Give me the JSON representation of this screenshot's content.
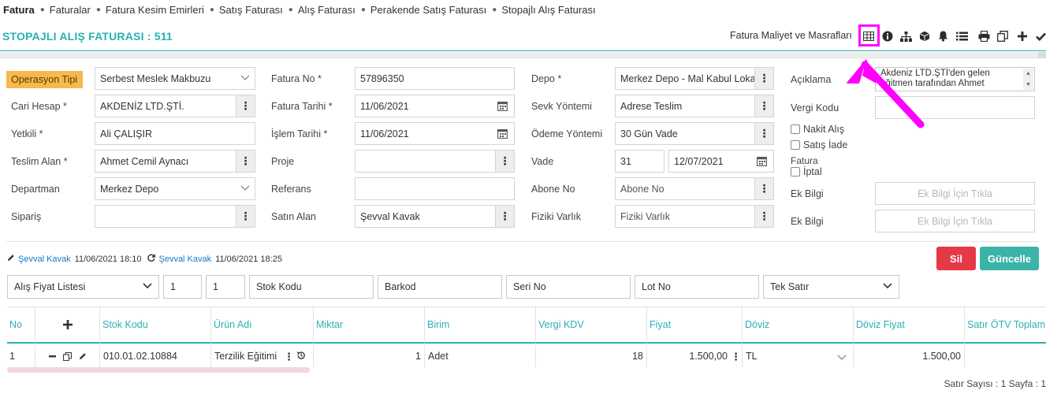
{
  "breadcrumb": [
    "Fatura",
    "Faturalar",
    "Fatura Kesim Emirleri",
    "Satış Faturası",
    "Alış Faturası",
    "Perakende Satış Faturası",
    "Stopajlı Alış Faturası"
  ],
  "header": {
    "title": "STOPAJLI ALIŞ FATURASI : 511",
    "cost_link": "Fatura Maliyet ve Masrafları",
    "toolbar_icons": [
      "table-icon",
      "info-icon",
      "sitemap-icon",
      "cube-icon",
      "bell-icon",
      "list-icon",
      "print-icon",
      "copy-icon",
      "plus-icon",
      "check-icon"
    ]
  },
  "form": {
    "operasyon_tipi": {
      "label": "Operasyon Tipi",
      "value": "Serbest Meslek Makbuzu"
    },
    "cari_hesap": {
      "label": "Cari Hesap *",
      "value": "AKDENİZ LTD.ŞTİ."
    },
    "yetkili": {
      "label": "Yetkili *",
      "value": "Ali ÇALIŞIR"
    },
    "teslim_alan": {
      "label": "Teslim Alan *",
      "value": "Ahmet Cemil Aynacı"
    },
    "departman": {
      "label": "Departman",
      "value": "Merkez Depo"
    },
    "siparis": {
      "label": "Sipariş",
      "value": ""
    },
    "fatura_no": {
      "label": "Fatura No *",
      "value": "57896350"
    },
    "fatura_tarihi": {
      "label": "Fatura Tarihi *",
      "value": "11/06/2021"
    },
    "islem_tarihi": {
      "label": "İşlem Tarihi *",
      "value": "11/06/2021"
    },
    "proje": {
      "label": "Proje",
      "value": ""
    },
    "referans": {
      "label": "Referans",
      "value": ""
    },
    "satin_alan": {
      "label": "Satın Alan",
      "value": "Şevval Kavak"
    },
    "depo": {
      "label": "Depo *",
      "value": "Merkez Depo - Mal Kabul Lokasyonu"
    },
    "sevk_yontemi": {
      "label": "Sevk Yöntemi",
      "value": "Adrese Teslim"
    },
    "odeme_yontemi": {
      "label": "Ödeme Yöntemi",
      "value": "30 Gün Vade"
    },
    "vade": {
      "label": "Vade",
      "days": "31",
      "date": "12/07/2021"
    },
    "abone_no": {
      "label": "Abone No",
      "placeholder": "Abone No"
    },
    "fiziki_varlik": {
      "label": "Fiziki Varlık",
      "placeholder": "Fiziki Varlık"
    },
    "aciklama": {
      "label": "Açıklama",
      "value": "Akdeniz LTD.ŞTİ'den gelen eğitmen tarafından  Ahmet"
    },
    "vergi_kodu": {
      "label": "Vergi Kodu",
      "value": ""
    },
    "nakit_alis": "Nakit Alış",
    "satis_iade": "Satış İade",
    "fatura_iptal_top": "Fatura",
    "fatura_iptal_bottom": "İptal",
    "ek_bilgi_1": {
      "label": "Ek Bilgi",
      "button": "Ek Bilgi İçin Tıkla"
    },
    "ek_bilgi_2": {
      "label": "Ek Bilgi",
      "button": "Ek Bilgi İçin Tıkla"
    }
  },
  "meta": {
    "created_by": "Şevval Kavak",
    "created_at": "11/06/2021 18:10",
    "updated_by": "Şevval Kavak",
    "updated_at": "11/06/2021 18:25"
  },
  "actions": {
    "delete": "Sil",
    "update": "Güncelle"
  },
  "filters": {
    "price_list": "Alış Fiyat Listesi",
    "qty1": "1",
    "qty2": "1",
    "stok_kodu": "Stok Kodu",
    "barkod": "Barkod",
    "seri_no": "Seri No",
    "lot_no": "Lot No",
    "row_mode": "Tek Satır"
  },
  "table": {
    "columns": [
      "No",
      "+",
      "Stok Kodu",
      "Ürün Adı",
      "Miktar",
      "Birim",
      "Vergi KDV",
      "Fiyat",
      "Döviz",
      "Döviz Fiyat",
      "Satır ÖTV Toplam"
    ],
    "rows": [
      {
        "no": "1",
        "stok_kodu": "010.01.02.10884",
        "urun_adi": "Terzilik Eğitimi",
        "miktar": "1",
        "birim": "Adet",
        "vergi_kdv": "18",
        "fiyat": "1.500,00",
        "doviz": "TL",
        "doviz_fiyat": "1.500,00",
        "otv": ""
      }
    ]
  },
  "footer": "Satır Sayısı : 1 Sayfa : 1",
  "colors": {
    "accent": "#2ab0b4",
    "highlight": "#ff00ff",
    "danger": "#e63946",
    "op_badge": "#f6b94d"
  }
}
